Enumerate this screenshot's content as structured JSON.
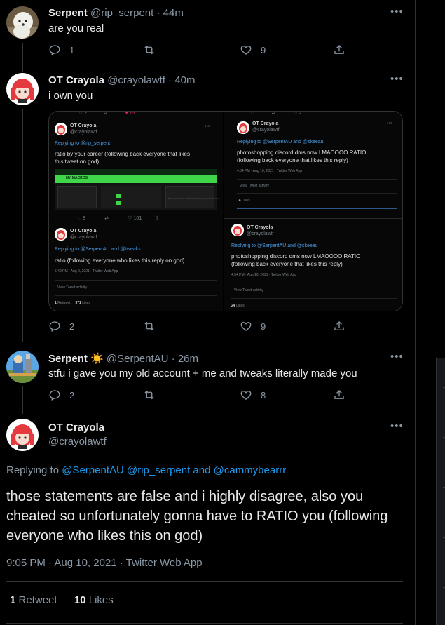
{
  "tweets": [
    {
      "name": "Serpent",
      "handle": "@rip_serpent",
      "time": "44m",
      "text": "are you real",
      "replies": "1",
      "likes": "9"
    },
    {
      "name": "OT Crayola",
      "handle": "@crayolawtf",
      "time": "40m",
      "text": "i own you",
      "replies": "2",
      "likes": "9"
    },
    {
      "name": "Serpent",
      "emoji": "☀️",
      "handle": "@SerpentAU",
      "time": "26m",
      "text": "stfu i gave you my old account + me and tweaks literally made you",
      "replies": "2",
      "likes": "8"
    }
  ],
  "embedded": {
    "left_top": {
      "name": "OT Crayola",
      "handle": "@crayolawtf",
      "replying": "Replying to @rip_serpent",
      "text1": "ratio by your career (following back everyone that likes",
      "text2": "this tweet on god)",
      "panel_title": "MY MACROS",
      "panel_text": "Once we have no available macros to your macro text"
    },
    "left_bottom": {
      "name": "OT Crayola",
      "handle": "@crayolawtf",
      "replying": "Replying to @SerpentAU and @tweaks",
      "text": "ratio (following everyone who likes this reply on god)",
      "meta": "5:49 PM · Aug 9, 2021 · Twitter Web App",
      "activity": "View Tweet activity",
      "retweets": "1",
      "retweets_label": "Retweet",
      "likes": "371",
      "likes_label": "Likes"
    },
    "right_top": {
      "name": "OT Crayola",
      "handle": "@crayolawtf",
      "replying": "Replying to @SerpentAU and @skeeau",
      "text1": "photoshopping discord dms now LMAOOOO RATIO",
      "text2": "(following back everyone that likes this reply)",
      "meta": "4:54 PM · Aug 10, 2021 · Twitter Web App",
      "activity": "View Tweet activity",
      "likes": "14",
      "likes_label": "Likes"
    },
    "right_bottom": {
      "name": "OT Crayola",
      "handle": "@crayolawtf",
      "replying": "Replying to @SerpentAU and @skeeau",
      "text1": "photoshopping discord dms now LMAOOOO RATIO",
      "text2": "(following back everyone that likes this reply)",
      "meta": "4:54 PM · Aug 10, 2021 · Twitter Web App",
      "activity": "View Tweet activity",
      "likes": "24",
      "likes_label": "Likes"
    }
  },
  "main": {
    "name": "OT Crayola",
    "handle": "@crayolawtf",
    "replying_prefix": "Replying to",
    "replying_to": "@SerpentAU @rip_serpent and @cammybearrr",
    "text": "those statements are false and i highly disagree, also you cheated so unfortunately gonna have to RATIO you (following everyone who likes this on god)",
    "meta": "9:05 PM · Aug 10, 2021 · Twitter Web App",
    "retweets": "1",
    "retweets_label": "Retweet",
    "likes": "10",
    "likes_label": "Likes"
  },
  "ui": {
    "more": "•••"
  },
  "colors": {
    "background": "#000000",
    "link": "#1d9bf0",
    "secondary": "#8b98a5",
    "primary": "#e7e9ea"
  }
}
